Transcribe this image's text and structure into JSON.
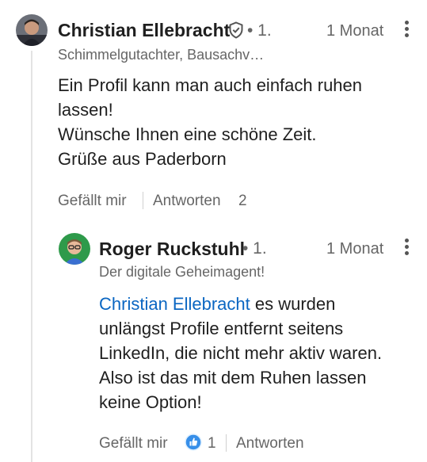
{
  "comment": {
    "author": "Christian Ellebracht",
    "degree": "• 1.",
    "time": "1 Monat",
    "headline": "Schimmelgutachter, Bausachv…",
    "text_lines": [
      "Ein Profil kann man auch einfach ruhen",
      "lassen!",
      "Wünsche Ihnen eine schöne Zeit.",
      "Grüße aus Paderborn"
    ],
    "like_label": "Gefällt mir",
    "reply_label": "Antworten",
    "reply_count": "2"
  },
  "reply": {
    "author": "Roger Ruckstuhl",
    "degree": "• 1.",
    "time": "1 Monat",
    "headline": "Der digitale Geheimagent!",
    "mention": "Christian Ellebracht",
    "text_first_rest": " es wurden",
    "text_lines": [
      "unlängst Profile entfernt seitens",
      "LinkedIn, die nicht mehr aktiv waren.",
      "Also ist das mit dem Ruhen lassen",
      "keine Option!"
    ],
    "like_label": "Gefällt mir",
    "reaction_count": "1",
    "reply_label": "Antworten"
  },
  "colors": {
    "link": "#0a66c2",
    "secondary_text": "#666666",
    "reaction_blue": "#378fe9"
  }
}
